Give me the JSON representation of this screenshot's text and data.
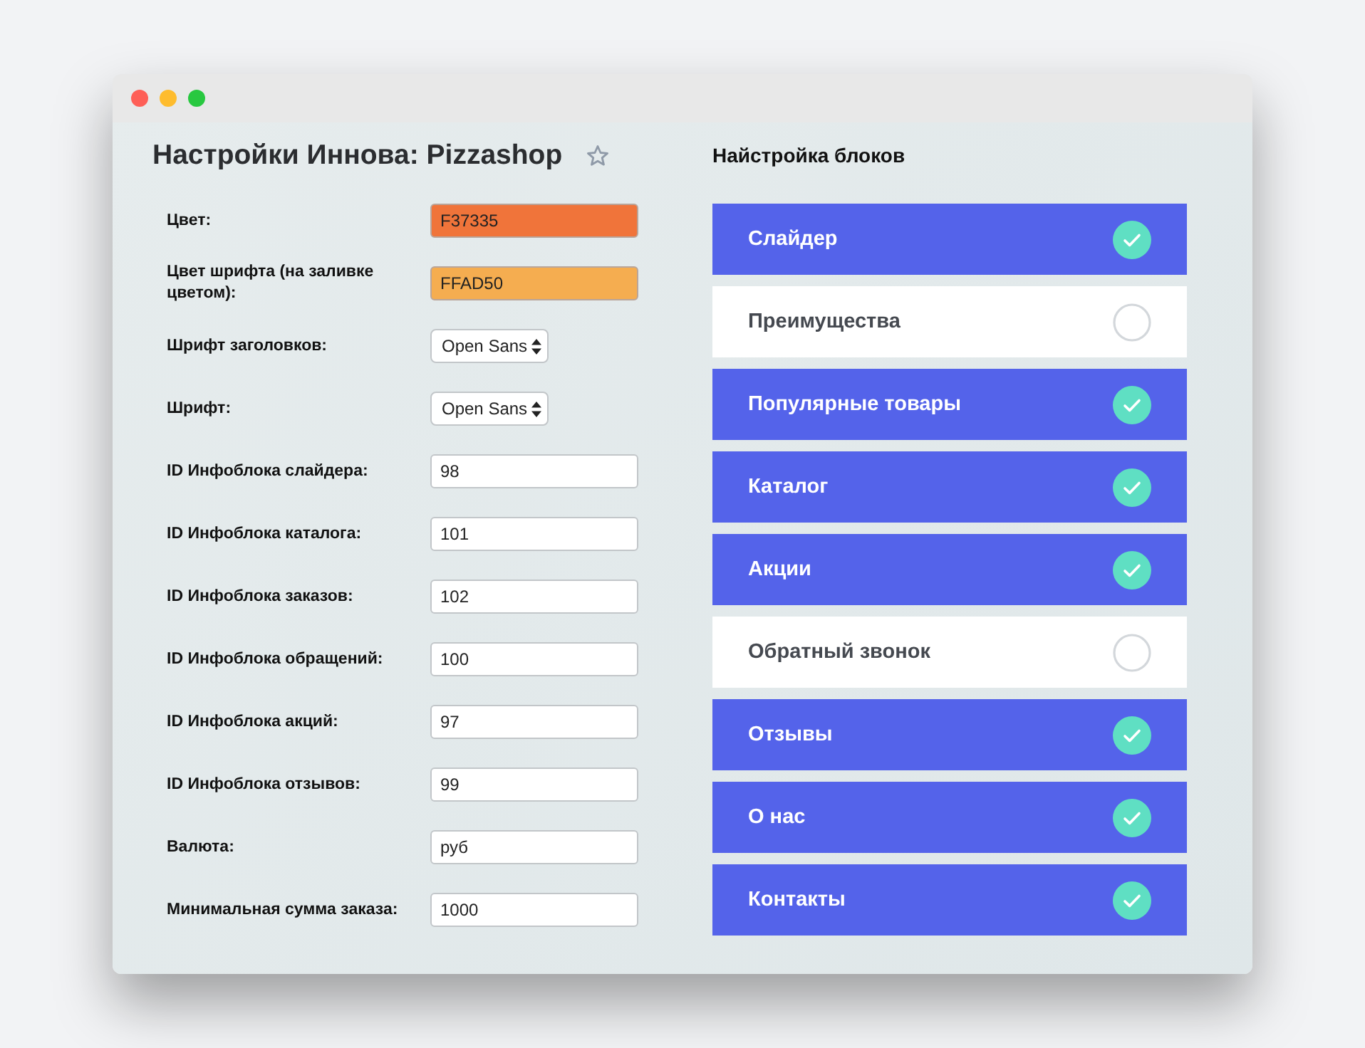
{
  "window": {
    "title": "Настройки Иннова: Pizzashop",
    "favorite": false
  },
  "settings": [
    {
      "kind": "color",
      "label": "Цвет:",
      "value": "F37335",
      "color": "#f0743a"
    },
    {
      "kind": "color",
      "label": "Цвет шрифта (на заливке цветом):",
      "value": "FFAD50",
      "color": "#f5ad50"
    },
    {
      "kind": "select",
      "label": "Шрифт заголовков:",
      "value": "Open Sans"
    },
    {
      "kind": "select",
      "label": "Шрифт:",
      "value": "Open Sans"
    },
    {
      "kind": "text",
      "label": "ID Инфоблока слайдера:",
      "value": "98"
    },
    {
      "kind": "text",
      "label": "ID Инфоблока каталога:",
      "value": "101"
    },
    {
      "kind": "text",
      "label": "ID Инфоблока заказов:",
      "value": "102"
    },
    {
      "kind": "text",
      "label": "ID Инфоблока обращений:",
      "value": "100"
    },
    {
      "kind": "text",
      "label": "ID Инфоблока акций:",
      "value": "97"
    },
    {
      "kind": "text",
      "label": "ID Инфоблока отзывов:",
      "value": "99"
    },
    {
      "kind": "text",
      "label": "Валюта:",
      "value": "руб"
    },
    {
      "kind": "text",
      "label": "Минимальная сумма заказа:",
      "value": "1000"
    }
  ],
  "blocks": {
    "title": "Найстройка блоков",
    "items": [
      {
        "label": "Слайдер",
        "checked": true
      },
      {
        "label": "Преимущества",
        "checked": false
      },
      {
        "label": "Популярные товары",
        "checked": true
      },
      {
        "label": "Каталог",
        "checked": true
      },
      {
        "label": "Акции",
        "checked": true
      },
      {
        "label": "Обратный звонок",
        "checked": false
      },
      {
        "label": "Отзывы",
        "checked": true
      },
      {
        "label": "О нас",
        "checked": true
      },
      {
        "label": "Контакты",
        "checked": true
      }
    ]
  }
}
